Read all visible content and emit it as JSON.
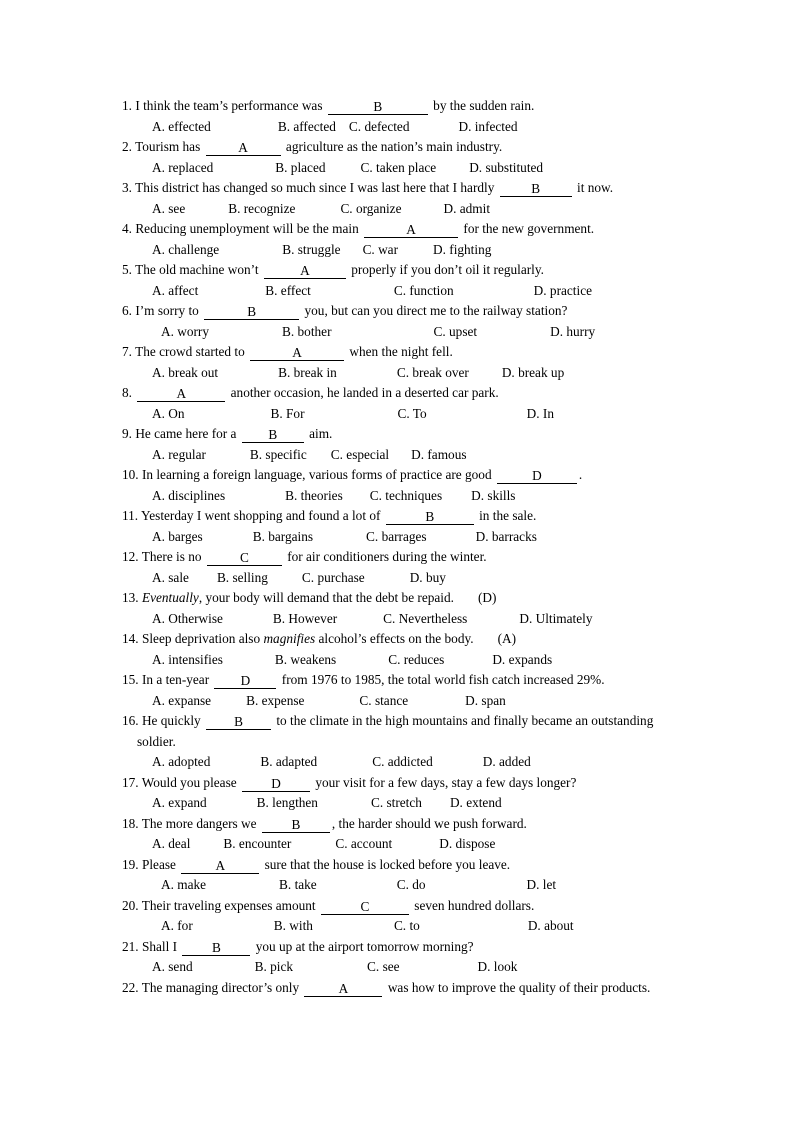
{
  "document": {
    "title": "Vocabulary Multiple Choice Exercise",
    "page_background": "#ffffff",
    "text_color": "#000000"
  },
  "questions": [
    {
      "number": "1.",
      "stem_pre": "I think the team’s performance was",
      "blank_answer": "B",
      "blank_width": 100,
      "stem_post": "by the sudden rain.",
      "options": [
        {
          "label": "A. effected",
          "indent": 15
        },
        {
          "label": "B. affected",
          "indent": 67
        },
        {
          "label": "C. defected",
          "indent": 13
        },
        {
          "label": "D. infected",
          "indent": 49
        }
      ]
    },
    {
      "number": "2.",
      "stem_pre": "Tourism has",
      "blank_answer": "A",
      "blank_width": 75,
      "stem_post": "agriculture as the nation’s main industry.",
      "options": [
        {
          "label": "A. replaced",
          "indent": 15
        },
        {
          "label": "B. placed",
          "indent": 62
        },
        {
          "label": "C. taken place",
          "indent": 35
        },
        {
          "label": "D. substituted",
          "indent": 33
        }
      ]
    },
    {
      "number": "3.",
      "stem_pre": "This district has changed so much since I was last here that I hardly",
      "blank_answer": "B",
      "blank_width": 72,
      "stem_post": "it now.",
      "options": [
        {
          "label": "A. see",
          "indent": 15
        },
        {
          "label": "B. recognize",
          "indent": 43
        },
        {
          "label": "C. organize",
          "indent": 45
        },
        {
          "label": "D. admit",
          "indent": 42
        }
      ]
    },
    {
      "number": "4.",
      "stem_pre": "Reducing unemployment will be the main",
      "blank_answer": "A",
      "blank_width": 94,
      "stem_post": "for the new government.",
      "options": [
        {
          "label": "A. challenge",
          "indent": 15
        },
        {
          "label": "B. struggle",
          "indent": 63
        },
        {
          "label": "C. war",
          "indent": 22
        },
        {
          "label": "D. fighting",
          "indent": 35
        }
      ]
    },
    {
      "number": "5.",
      "stem_pre": "The old machine won’t",
      "blank_answer": "A",
      "blank_width": 82,
      "stem_post": "properly if you don’t oil it regularly.",
      "options": [
        {
          "label": "A. affect",
          "indent": 15
        },
        {
          "label": "B. effect",
          "indent": 67
        },
        {
          "label": "C. function",
          "indent": 83
        },
        {
          "label": "D. practice",
          "indent": 80
        }
      ]
    },
    {
      "number": "6.",
      "stem_pre": "I’m sorry to",
      "blank_answer": "B",
      "blank_width": 95,
      "stem_post": "you, but can you direct me to the railway station?",
      "options": [
        {
          "label": "A. worry",
          "indent": 24
        },
        {
          "label": "B. bother",
          "indent": 73
        },
        {
          "label": "C. upset",
          "indent": 102
        },
        {
          "label": "D. hurry",
          "indent": 73
        }
      ]
    },
    {
      "number": "7.",
      "stem_pre": "The crowd started to",
      "blank_answer": "A",
      "blank_width": 94,
      "stem_post": "when the night fell.",
      "options": [
        {
          "label": "A. break out",
          "indent": 15
        },
        {
          "label": "B. break in",
          "indent": 60
        },
        {
          "label": "C. break over",
          "indent": 60
        },
        {
          "label": "D. break up",
          "indent": 33
        }
      ]
    },
    {
      "number": "8.",
      "stem_pre": "",
      "blank_answer": "A",
      "blank_width": 88,
      "stem_post": "another occasion, he landed in a deserted car park.",
      "options": [
        {
          "label": "A. On",
          "indent": 15
        },
        {
          "label": "B. For",
          "indent": 86
        },
        {
          "label": "C. To",
          "indent": 93
        },
        {
          "label": "D. In",
          "indent": 100
        }
      ]
    },
    {
      "number": "9.",
      "stem_pre": "He came here for a",
      "blank_answer": "B",
      "blank_width": 62,
      "stem_post": "aim.",
      "options": [
        {
          "label": "A. regular",
          "indent": 15
        },
        {
          "label": "B. specific",
          "indent": 44
        },
        {
          "label": "C. especial",
          "indent": 24
        },
        {
          "label": "D. famous",
          "indent": 22
        }
      ]
    },
    {
      "number": "10.",
      "stem_pre": "In learning a foreign language, various forms of practice are good",
      "blank_answer": "D",
      "blank_width": 80,
      "stem_post": ".",
      "options": [
        {
          "label": "A. disciplines",
          "indent": 15
        },
        {
          "label": "B. theories",
          "indent": 60
        },
        {
          "label": "C. techniques",
          "indent": 27
        },
        {
          "label": "D. skills",
          "indent": 29
        }
      ]
    },
    {
      "number": "11.",
      "stem_pre": "Yesterday I went shopping and found a lot of",
      "blank_answer": "B",
      "blank_width": 88,
      "stem_post": "in the sale.",
      "options": [
        {
          "label": "A. barges",
          "indent": 15
        },
        {
          "label": "B. bargains",
          "indent": 50
        },
        {
          "label": "C. barrages",
          "indent": 53
        },
        {
          "label": "D. barracks",
          "indent": 49
        }
      ]
    },
    {
      "number": "12.",
      "stem_pre": "There is no",
      "blank_answer": "C",
      "blank_width": 75,
      "stem_post": "for air conditioners during the winter.",
      "options": [
        {
          "label": "A. sale",
          "indent": 15
        },
        {
          "label": "B. selling",
          "indent": 28
        },
        {
          "label": "C. purchase",
          "indent": 34
        },
        {
          "label": "D. buy",
          "indent": 45
        }
      ]
    },
    {
      "number": "13.",
      "stem_pre": "",
      "italic_word": "Eventually",
      "stem_post_italic": ", your body will demand that the debt be repaid.",
      "paren_answer": "(D)",
      "options": [
        {
          "label": "A. Otherwise",
          "indent": 15
        },
        {
          "label": "B. However",
          "indent": 50
        },
        {
          "label": "C. Nevertheless",
          "indent": 46
        },
        {
          "label": "D. Ultimately",
          "indent": 52
        }
      ]
    },
    {
      "number": "14.",
      "stem_pre": "Sleep deprivation also",
      "italic_word": "magnifies",
      "stem_post_italic": "alcohol’s effects on the body.",
      "paren_answer": "(A)",
      "options": [
        {
          "label": "A. intensifies",
          "indent": 15
        },
        {
          "label": "B. weakens",
          "indent": 52
        },
        {
          "label": "C. reduces",
          "indent": 52
        },
        {
          "label": "D. expands",
          "indent": 48
        }
      ]
    },
    {
      "number": "15.",
      "stem_pre": "In a ten-year",
      "blank_answer": "D",
      "blank_width": 62,
      "stem_post": "from 1976 to 1985, the total world fish catch increased 29%.",
      "options": [
        {
          "label": "A. expanse",
          "indent": 15
        },
        {
          "label": "B. expense",
          "indent": 35
        },
        {
          "label": "C. stance",
          "indent": 55
        },
        {
          "label": "D. span",
          "indent": 57
        }
      ]
    },
    {
      "number": "16.",
      "stem_pre": "He quickly",
      "blank_answer": "B",
      "blank_width": 65,
      "stem_post": "to the climate in the high mountains and finally became an outstanding",
      "continuation": "soldier.",
      "options": [
        {
          "label": "A. adopted",
          "indent": 15
        },
        {
          "label": "B. adapted",
          "indent": 50
        },
        {
          "label": "C. addicted",
          "indent": 55
        },
        {
          "label": "D. added",
          "indent": 50
        }
      ]
    },
    {
      "number": "17.",
      "stem_pre": "Would you please",
      "blank_answer": "D",
      "blank_width": 68,
      "stem_post": "your visit for a few days, stay a few days longer?",
      "options": [
        {
          "label": "A. expand",
          "indent": 15
        },
        {
          "label": "B. lengthen",
          "indent": 50
        },
        {
          "label": "C. stretch",
          "indent": 53
        },
        {
          "label": "D. extend",
          "indent": 28
        }
      ]
    },
    {
      "number": "18.",
      "stem_pre": "The more dangers we",
      "blank_answer": "B",
      "blank_width": 68,
      "stem_post": ", the harder should we push forward.",
      "options": [
        {
          "label": "A. deal",
          "indent": 15
        },
        {
          "label": "B. encounter",
          "indent": 33
        },
        {
          "label": "C. account",
          "indent": 44
        },
        {
          "label": "D. dispose",
          "indent": 47
        }
      ]
    },
    {
      "number": "19.",
      "stem_pre": "Please",
      "blank_answer": "A",
      "blank_width": 78,
      "stem_post": "sure that the house is locked before you leave.",
      "options": [
        {
          "label": "A. make",
          "indent": 24
        },
        {
          "label": "B. take",
          "indent": 73
        },
        {
          "label": "C. do",
          "indent": 80
        },
        {
          "label": "D. let",
          "indent": 101
        }
      ]
    },
    {
      "number": "20.",
      "stem_pre": "Their traveling expenses amount",
      "blank_answer": "C",
      "blank_width": 88,
      "stem_post": "seven hundred dollars.",
      "options": [
        {
          "label": "A. for",
          "indent": 24
        },
        {
          "label": "B. with",
          "indent": 81
        },
        {
          "label": "C. to",
          "indent": 81
        },
        {
          "label": "D. about",
          "indent": 108
        }
      ]
    },
    {
      "number": "21.",
      "stem_pre": "Shall I",
      "blank_answer": "B",
      "blank_width": 68,
      "stem_post": "you up at the airport tomorrow morning?",
      "options": [
        {
          "label": "A. send",
          "indent": 15
        },
        {
          "label": "B. pick",
          "indent": 62
        },
        {
          "label": "C. see",
          "indent": 74
        },
        {
          "label": "D. look",
          "indent": 78
        }
      ]
    },
    {
      "number": "22.",
      "stem_pre": "The managing director’s only",
      "blank_answer": "A",
      "blank_width": 78,
      "stem_post": "was how to improve the quality of their products.",
      "options": []
    }
  ]
}
